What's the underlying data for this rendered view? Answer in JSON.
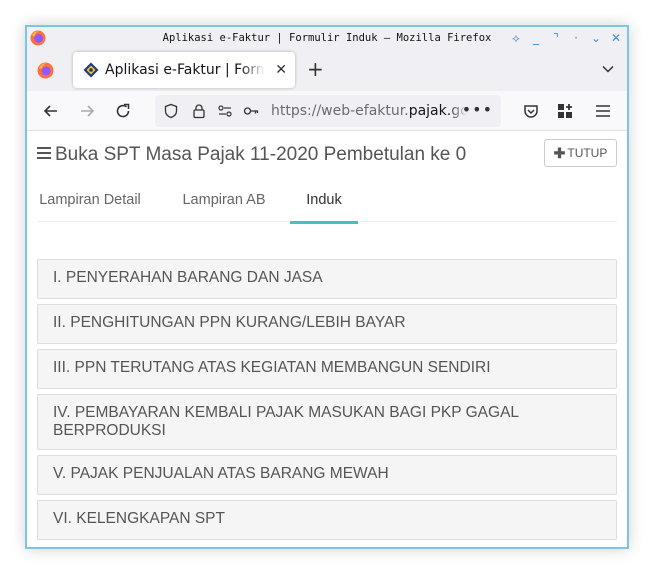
{
  "window": {
    "title": "Aplikasi e-Faktur | Formulir Induk — Mozilla Firefox"
  },
  "browser": {
    "tab_title": "Aplikasi e-Faktur | Formulir Induk",
    "url_prefix": "https://web-efaktur.",
    "url_domain": "pajak.go.id"
  },
  "page": {
    "title": "Buka SPT Masa Pajak 11-2020 Pembetulan ke 0",
    "close_label": "TUTUP",
    "tabs": [
      {
        "label": "Lampiran Detail",
        "active": false
      },
      {
        "label": "Lampiran AB",
        "active": false
      },
      {
        "label": "Induk",
        "active": true
      }
    ],
    "sections": [
      "I. PENYERAHAN BARANG DAN JASA",
      "II. PENGHITUNGAN PPN KURANG/LEBIH BAYAR",
      "III. PPN TERUTANG ATAS KEGIATAN MEMBANGUN SENDIRI",
      "IV. PEMBAYARAN KEMBALI PAJAK MASUKAN BAGI PKP GAGAL BERPRODUKSI",
      "V. PAJAK PENJUALAN ATAS BARANG MEWAH",
      "VI. KELENGKAPAN SPT"
    ],
    "accent_color": "#4bbfbf"
  }
}
